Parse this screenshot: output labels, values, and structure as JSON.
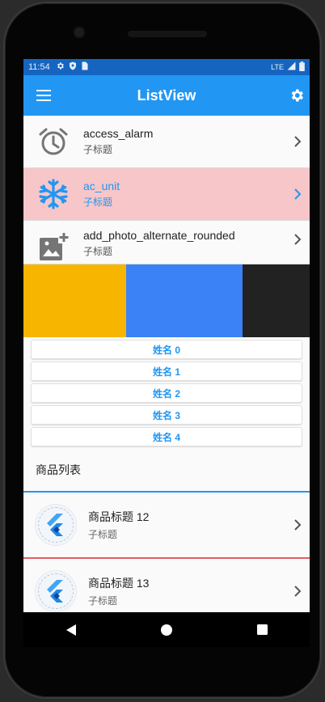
{
  "statusbar": {
    "time": "11:54",
    "network": "LTE",
    "icons": [
      "gear-icon",
      "shield-icon",
      "sim-card-icon",
      "signal-icon",
      "battery-icon"
    ]
  },
  "appbar": {
    "title": "ListView",
    "menu_icon": "menu-icon",
    "settings_icon": "gear-icon",
    "color": "#2196f3",
    "status_color": "#1565c0"
  },
  "tiles": [
    {
      "title": "access_alarm",
      "subtitle": "子标题",
      "icon": "alarm-icon"
    },
    {
      "title": "ac_unit",
      "subtitle": "子标题",
      "icon": "snowflake-icon",
      "selected": true
    },
    {
      "title": "add_photo_alternate_rounded",
      "subtitle": "子标题",
      "icon": "add-photo-icon"
    }
  ],
  "color_blocks": [
    "#f7b500",
    "#3b82f6",
    "#222222"
  ],
  "names": [
    "姓名 0",
    "姓名 1",
    "姓名 2",
    "姓名 3",
    "姓名 4"
  ],
  "section_title": "商品列表",
  "products": [
    {
      "title": "商品标题 12",
      "subtitle": "子标题",
      "divider_color": "#2196f3"
    },
    {
      "title": "商品标题 13",
      "subtitle": "子标题",
      "divider_color": "#e35d5d"
    }
  ],
  "colors": {
    "accent": "#2196f3",
    "selected_bg": "#f6c6c9"
  },
  "navbar": {
    "icons": [
      "back-icon",
      "home-icon",
      "recents-icon"
    ]
  }
}
